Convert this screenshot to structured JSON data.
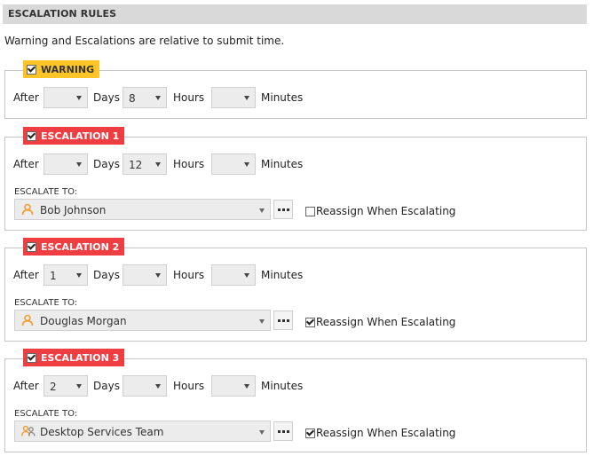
{
  "header": {
    "title": "ESCALATION RULES"
  },
  "intro": "Warning and Escalations are relative to submit time.",
  "labels": {
    "after": "After",
    "days": "Days",
    "hours": "Hours",
    "minutes": "Minutes",
    "escalate_to": "ESCALATE TO:",
    "reassign": "Reassign When Escalating"
  },
  "warning": {
    "title": "WARNING",
    "checked": true,
    "days": "",
    "hours": "8",
    "minutes": ""
  },
  "escalations": [
    {
      "title": "ESCALATION 1",
      "checked": true,
      "days": "",
      "hours": "12",
      "minutes": "",
      "assignee": "Bob Johnson",
      "assignee_type": "user-icon",
      "reassign": false
    },
    {
      "title": "ESCALATION 2",
      "checked": true,
      "days": "1",
      "hours": "",
      "minutes": "",
      "assignee": "Douglas Morgan",
      "assignee_type": "user-icon",
      "reassign": true
    },
    {
      "title": "ESCALATION 3",
      "checked": true,
      "days": "2",
      "hours": "",
      "minutes": "",
      "assignee": "Desktop Services Team",
      "assignee_type": "team-icon",
      "reassign": true
    }
  ],
  "colors": {
    "warning": "#ffc425",
    "escalation": "#ef3e42",
    "user_icon": "#f39c32"
  }
}
